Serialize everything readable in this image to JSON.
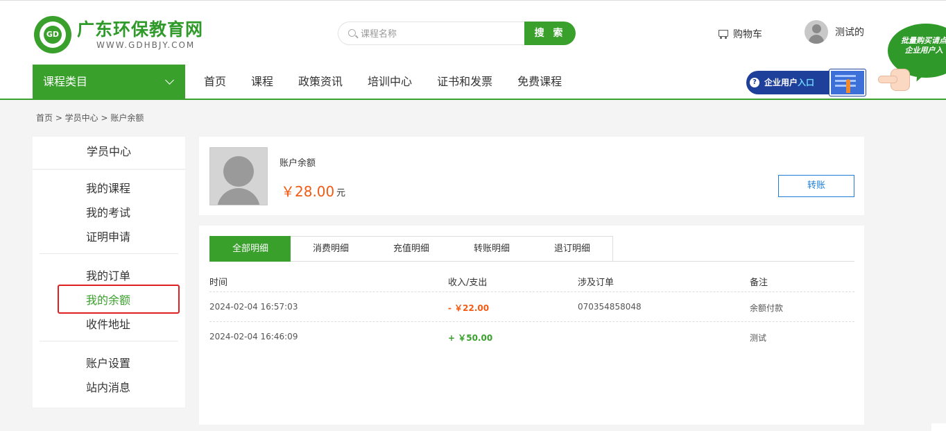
{
  "site": {
    "logo_badge": "GD",
    "name": "广东环保教育网",
    "url": "WWW.GDHBJY.COM"
  },
  "search": {
    "placeholder": "课程名称",
    "button": "搜 索"
  },
  "header": {
    "cart": "购物车",
    "username": "测试的",
    "promo_line1": "批量购买请点",
    "promo_line2": "企业用户入",
    "enterprise_prefix": "企业用户",
    "enterprise_highlight": "入口",
    "enterprise_q": "?"
  },
  "nav": {
    "category": "课程类目",
    "items": [
      "首页",
      "课程",
      "政策资讯",
      "培训中心",
      "证书和发票",
      "免费课程"
    ]
  },
  "breadcrumb": "首页 > 学员中心 > 账户余额",
  "sidebar": {
    "title": "学员中心",
    "items": [
      "我的课程",
      "我的考试",
      "证明申请",
      "我的订单",
      "我的余额",
      "收件地址",
      "账户设置",
      "站内消息"
    ]
  },
  "balance": {
    "label": "账户余额",
    "amount": "￥28.00",
    "unit": "元",
    "transfer_button": "转账"
  },
  "tabs": [
    "全部明细",
    "消费明细",
    "充值明细",
    "转账明细",
    "退订明细"
  ],
  "table": {
    "headers": [
      "时间",
      "收入/支出",
      "涉及订单",
      "备注"
    ],
    "rows": [
      {
        "time": "2024-02-04 16:57:03",
        "amount": "- ￥22.00",
        "order": "070354858048",
        "note": "余额付款"
      },
      {
        "time": "2024-02-04 16:46:09",
        "amount": "+ ￥50.00",
        "order": "",
        "note": "测试"
      }
    ]
  },
  "colors": {
    "brand_green": "#3aa02c",
    "expense_orange": "#f25a13",
    "link_blue": "#1e7ed6",
    "highlight_red": "#e02020"
  }
}
